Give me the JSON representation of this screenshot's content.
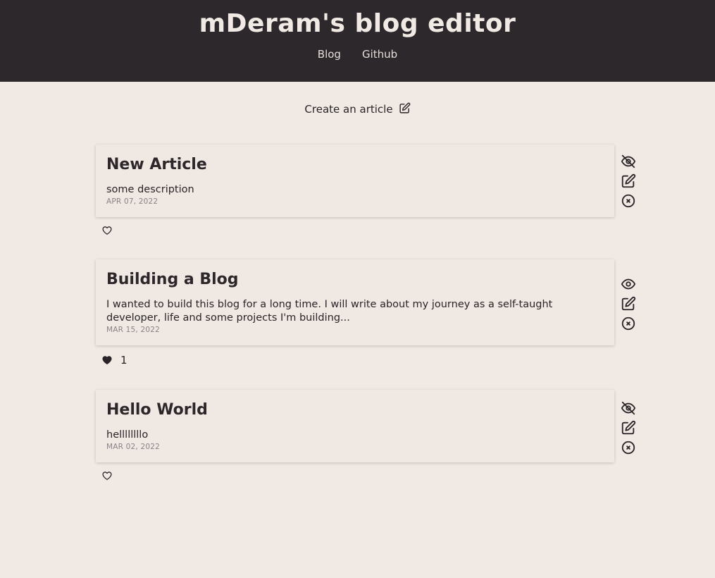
{
  "header": {
    "title": "mDeram's blog editor",
    "nav": [
      {
        "label": "Blog"
      },
      {
        "label": "Github"
      }
    ]
  },
  "create": {
    "label": "Create an article",
    "icon": "edit-icon"
  },
  "articles": [
    {
      "title": "New Article",
      "description": "some description",
      "date": "APR 07, 2022",
      "visibility_icon": "eye-off-icon",
      "liked": false,
      "likes": ""
    },
    {
      "title": "Building a Blog",
      "description": "I wanted to build this blog for a long time. I will write about my journey as a self-taught developer, life and some projects I'm building...",
      "date": "MAR 15, 2022",
      "visibility_icon": "eye-icon",
      "liked": true,
      "likes": "1"
    },
    {
      "title": "Hello World",
      "description": "hellllllllo",
      "date": "MAR 02, 2022",
      "visibility_icon": "eye-off-icon",
      "liked": false,
      "likes": ""
    }
  ],
  "colors": {
    "header_bg": "#2d282c",
    "page_bg": "#f0e9e4",
    "text": "#2a2428",
    "date": "#8a8286"
  }
}
